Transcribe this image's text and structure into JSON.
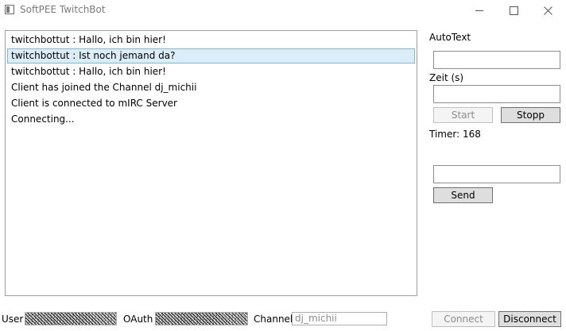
{
  "window": {
    "title": "SoftPEE TwitchBot",
    "controls": [
      "minimize-icon",
      "maximize-icon",
      "close-icon"
    ]
  },
  "messages": [
    {
      "text": "twitchbottut : Hallo, ich bin hier!",
      "selected": false
    },
    {
      "text": "twitchbottut : Ist noch jemand da?",
      "selected": true
    },
    {
      "text": "twitchbottut : Hallo, ich bin hier!",
      "selected": false
    },
    {
      "text": "Client has joined the Channel dj_michii",
      "selected": false
    },
    {
      "text": "Client is connected to mIRC Server",
      "selected": false
    },
    {
      "text": "Connecting...",
      "selected": false
    }
  ],
  "autotext": {
    "label": "AutoText",
    "value": "",
    "interval_label": "Zeit (s)",
    "interval_value": "",
    "start_label": "Start",
    "stop_label": "Stopp",
    "timer_label": "Timer: 168"
  },
  "send": {
    "value": "",
    "button_label": "Send"
  },
  "connection": {
    "user_label": "User",
    "oauth_label": "OAuth",
    "channel_label": "Channel",
    "channel_value": "dj_michii",
    "connect_label": "Connect",
    "disconnect_label": "Disconnect"
  },
  "colors": {
    "selection_bg": "#dbedf7",
    "selection_border": "#79b9dc",
    "button_bg": "#dedede",
    "disabled_text": "#8c8c8c"
  }
}
